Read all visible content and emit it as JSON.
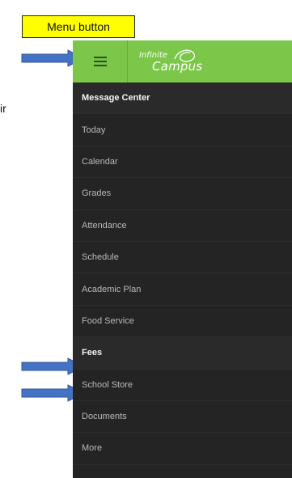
{
  "annotation": {
    "callout_label": "Menu button",
    "callout_bg": "#ffff00",
    "arrow_color": "#4472c4",
    "stray_text": "ir"
  },
  "app": {
    "logo_line1": "Infinite",
    "logo_line2": "Campus",
    "header_color": "#7cc64a",
    "menu_icon": "hamburger-icon"
  },
  "nav": {
    "items": [
      {
        "label": "Message Center",
        "emphasis": true
      },
      {
        "label": "Today",
        "emphasis": false
      },
      {
        "label": "Calendar",
        "emphasis": false
      },
      {
        "label": "Grades",
        "emphasis": false
      },
      {
        "label": "Attendance",
        "emphasis": false
      },
      {
        "label": "Schedule",
        "emphasis": false
      },
      {
        "label": "Academic Plan",
        "emphasis": false
      },
      {
        "label": "Food Service",
        "emphasis": false
      },
      {
        "label": "Fees",
        "emphasis": true
      },
      {
        "label": "School Store",
        "emphasis": false
      },
      {
        "label": "Documents",
        "emphasis": false
      },
      {
        "label": "More",
        "emphasis": false
      }
    ]
  }
}
